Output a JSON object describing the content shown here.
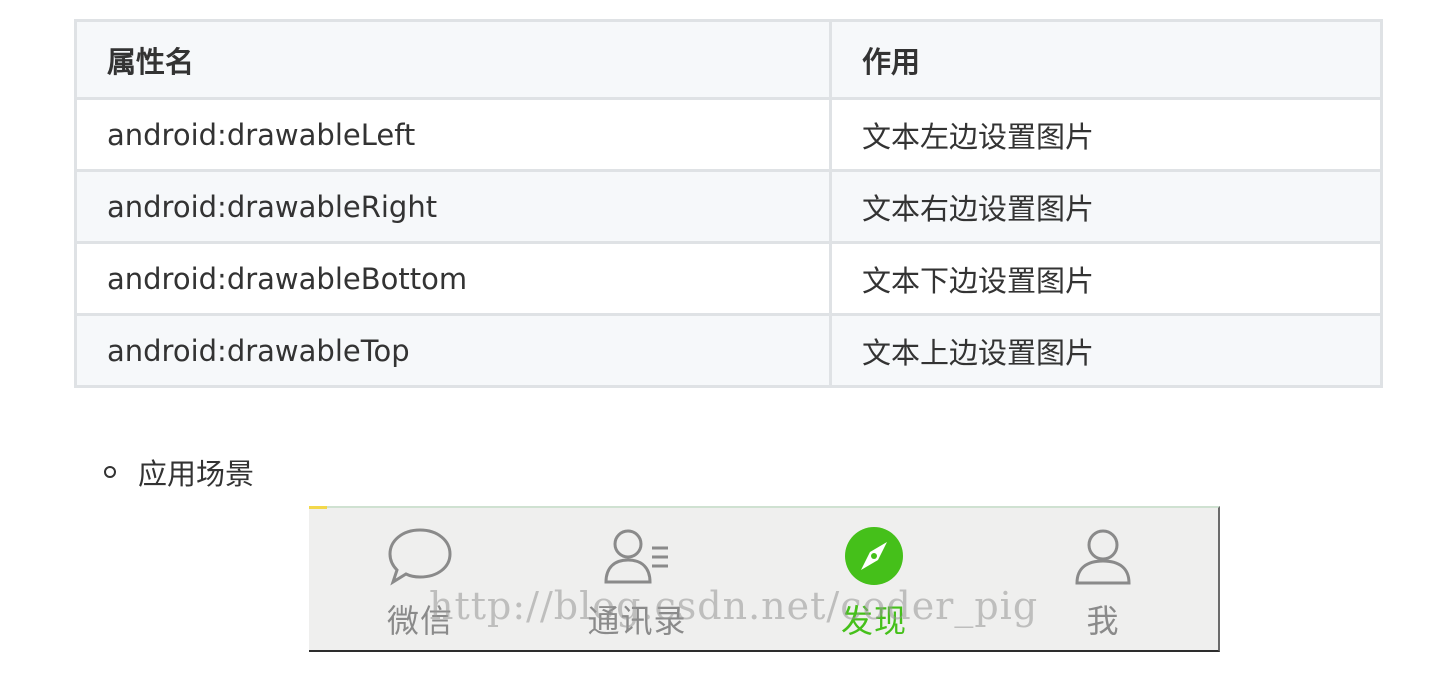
{
  "table": {
    "headers": [
      "属性名",
      "作用"
    ],
    "rows": [
      {
        "name": "android:drawableLeft",
        "effect": "文本左边设置图片"
      },
      {
        "name": "android:drawableRight",
        "effect": "文本右边设置图片"
      },
      {
        "name": "android:drawableBottom",
        "effect": "文本下边设置图片"
      },
      {
        "name": "android:drawableTop",
        "effect": "文本上边设置图片"
      }
    ]
  },
  "bullet": {
    "text": "应用场景"
  },
  "tabbar": {
    "tabs": [
      {
        "label": "微信",
        "icon": "chat-bubble-icon",
        "active": false
      },
      {
        "label": "通讯录",
        "icon": "contacts-icon",
        "active": false
      },
      {
        "label": "发现",
        "icon": "compass-icon",
        "active": true
      },
      {
        "label": "我",
        "icon": "person-icon",
        "active": false
      }
    ],
    "watermark": "http://blog.csdn.net/coder_pig",
    "active_color": "#45c01a",
    "inactive_color": "#8a8a8a"
  }
}
